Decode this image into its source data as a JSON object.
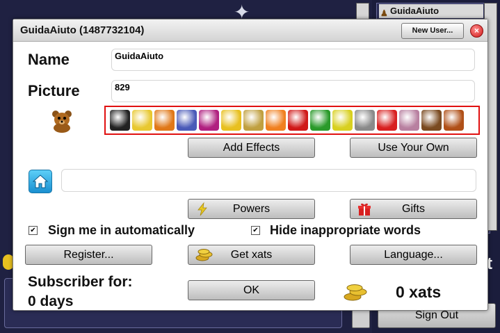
{
  "background": {
    "userlist_name": "GuidaAiuto",
    "signout_label": "Sign Out",
    "side_letter": "t"
  },
  "dialog": {
    "title": "GuidaAiuto (1487732104)",
    "new_user_label": "New User...",
    "close_label": "×"
  },
  "form": {
    "name_label": "Name",
    "name_value": "GuidaAiuto",
    "picture_label": "Picture",
    "picture_value": "829",
    "home_value": ""
  },
  "buttons": {
    "add_effects": "Add Effects",
    "use_your_own": "Use Your Own",
    "powers": "Powers",
    "gifts": "Gifts",
    "register": "Register...",
    "get_xats": "Get xats",
    "language": "Language...",
    "ok": "OK"
  },
  "options": {
    "sign_in_auto": "Sign me in automatically",
    "sign_in_auto_checked": true,
    "hide_words": "Hide inappropriate words",
    "hide_words_checked": true
  },
  "footer": {
    "subscriber_line1": "Subscriber for:",
    "subscriber_line2": "0 days",
    "xats": "0 xats"
  },
  "avatars": [
    {
      "name": "einstein-avatar-icon",
      "color": "#222222"
    },
    {
      "name": "simpson-avatar-icon",
      "color": "#e8c830"
    },
    {
      "name": "duck-avatar-icon",
      "color": "#e07818"
    },
    {
      "name": "dragon-avatar-icon",
      "color": "#4a5ab8"
    },
    {
      "name": "monster-avatar-icon",
      "color": "#b02080"
    },
    {
      "name": "police-avatar-icon",
      "color": "#e8c020"
    },
    {
      "name": "robot-avatar-icon",
      "color": "#c0a040"
    },
    {
      "name": "hand-avatar-icon",
      "color": "#f08020"
    },
    {
      "name": "lips-avatar-icon",
      "color": "#d01818"
    },
    {
      "name": "green-monster-avatar-icon",
      "color": "#2a9a2a"
    },
    {
      "name": "yellow-dino-avatar-icon",
      "color": "#d8d020"
    },
    {
      "name": "grey-robot-avatar-icon",
      "color": "#8a8a8a"
    },
    {
      "name": "red-creature-avatar-icon",
      "color": "#d82020"
    },
    {
      "name": "anime-girl-avatar-icon",
      "color": "#b880a0"
    },
    {
      "name": "brown-creature-avatar-icon",
      "color": "#7a4a20"
    },
    {
      "name": "bearded-face-avatar-icon",
      "color": "#b05018"
    }
  ]
}
